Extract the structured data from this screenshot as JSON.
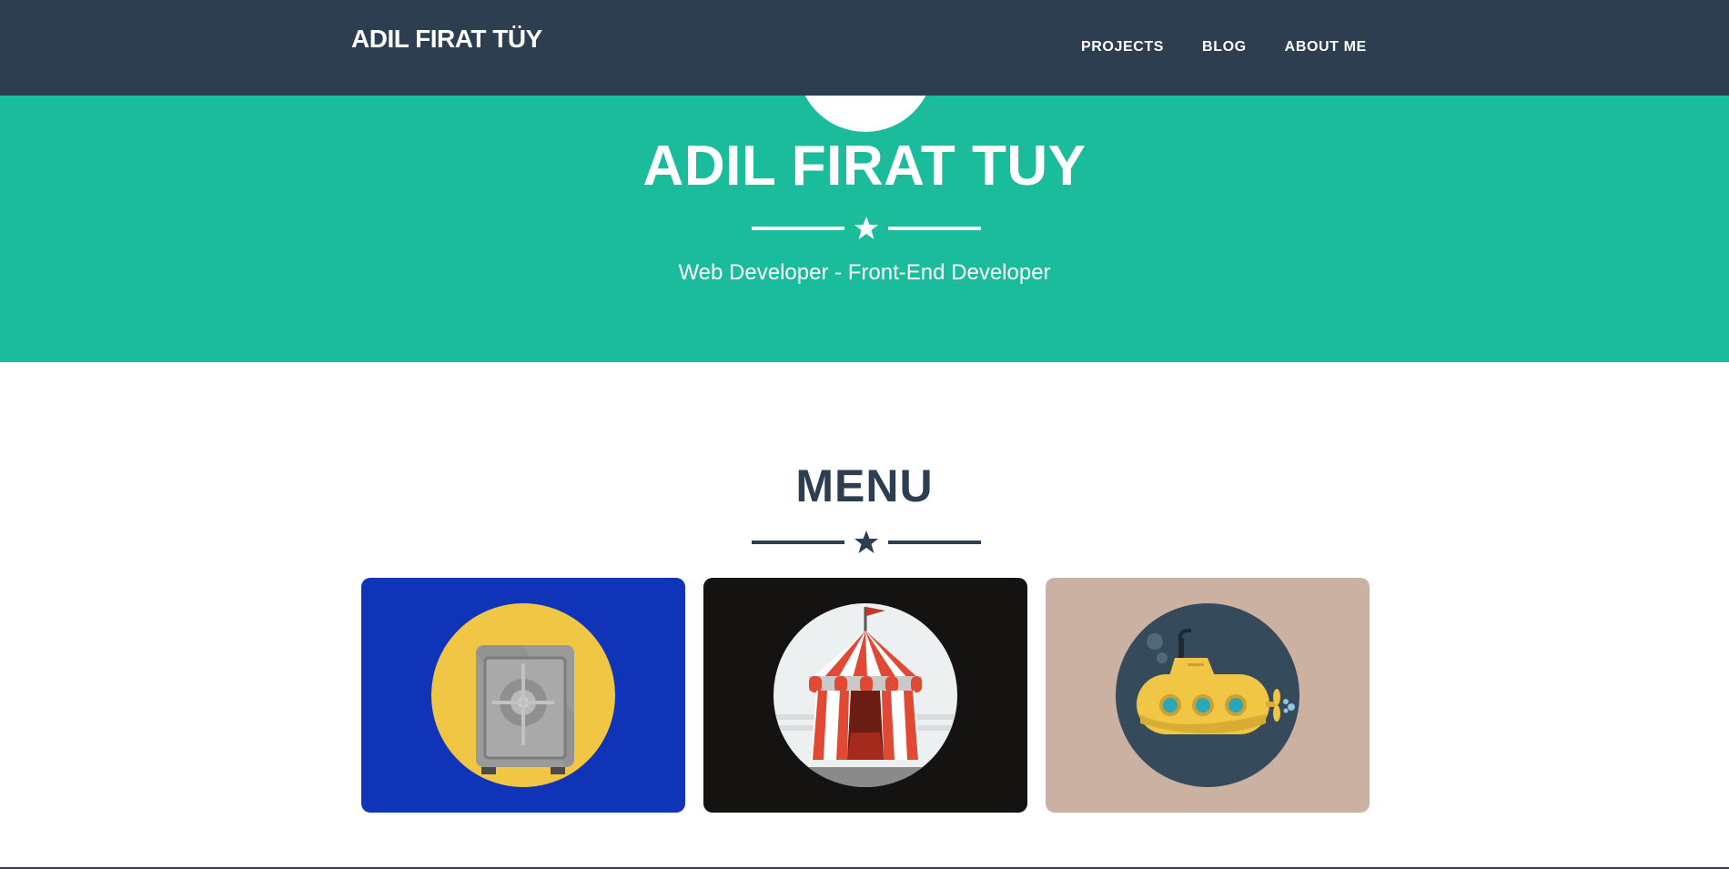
{
  "navbar": {
    "brand": "ADIL FIRAT TÜY",
    "links": [
      {
        "label": "PROJECTS"
      },
      {
        "label": "BLOG"
      },
      {
        "label": "ABOUT ME"
      }
    ]
  },
  "hero": {
    "title": "ADIL FIRAT TUY",
    "subtitle": "Web Developer - Front-End Developer",
    "divider_icon": "star-icon"
  },
  "menu": {
    "title": "MENU",
    "divider_icon": "star-icon",
    "items": [
      {
        "icon": "safe-icon",
        "background": "#1034b8",
        "circle": "#f0c644"
      },
      {
        "icon": "circus-tent-icon",
        "background": "#151212",
        "circle": "#ecf0f1"
      },
      {
        "icon": "submarine-icon",
        "background": "#cbb1a2",
        "circle": "#354b5b"
      }
    ]
  },
  "colors": {
    "navbar": "#2c3e50",
    "hero": "#1abc9c",
    "text_dark": "#2c3e50"
  }
}
